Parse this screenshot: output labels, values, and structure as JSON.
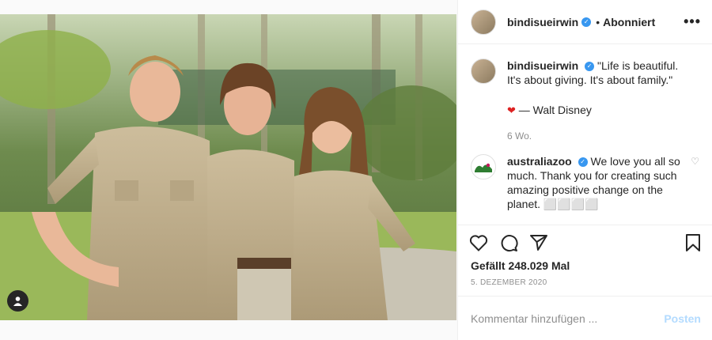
{
  "header": {
    "username": "bindisueirwin",
    "separator": "•",
    "follow_status": "Abonniert",
    "more": "•••"
  },
  "caption": {
    "username": "bindisueirwin",
    "text": "\"Life is beautiful. It's about giving. It's about family.\"",
    "attribution": "— Walt Disney",
    "time": "6 Wo."
  },
  "comments": [
    {
      "username": "australiazoo",
      "text": "We love you all so much. Thank you for creating such amazing positive change on the planet. ⬜⬜⬜⬜"
    }
  ],
  "likes_text": "Gefällt 248.029 Mal",
  "post_date": "5. DEZEMBER 2020",
  "comment_box": {
    "placeholder": "Kommentar hinzufügen ...",
    "post_label": "Posten"
  },
  "colors": {
    "verified": "#3897f0",
    "post_button_disabled": "#b3dbff",
    "shirt": "#bfae8c"
  },
  "icons": [
    "heart-icon",
    "comment-icon",
    "share-icon",
    "bookmark-icon",
    "user-tag-icon",
    "more-icon"
  ]
}
